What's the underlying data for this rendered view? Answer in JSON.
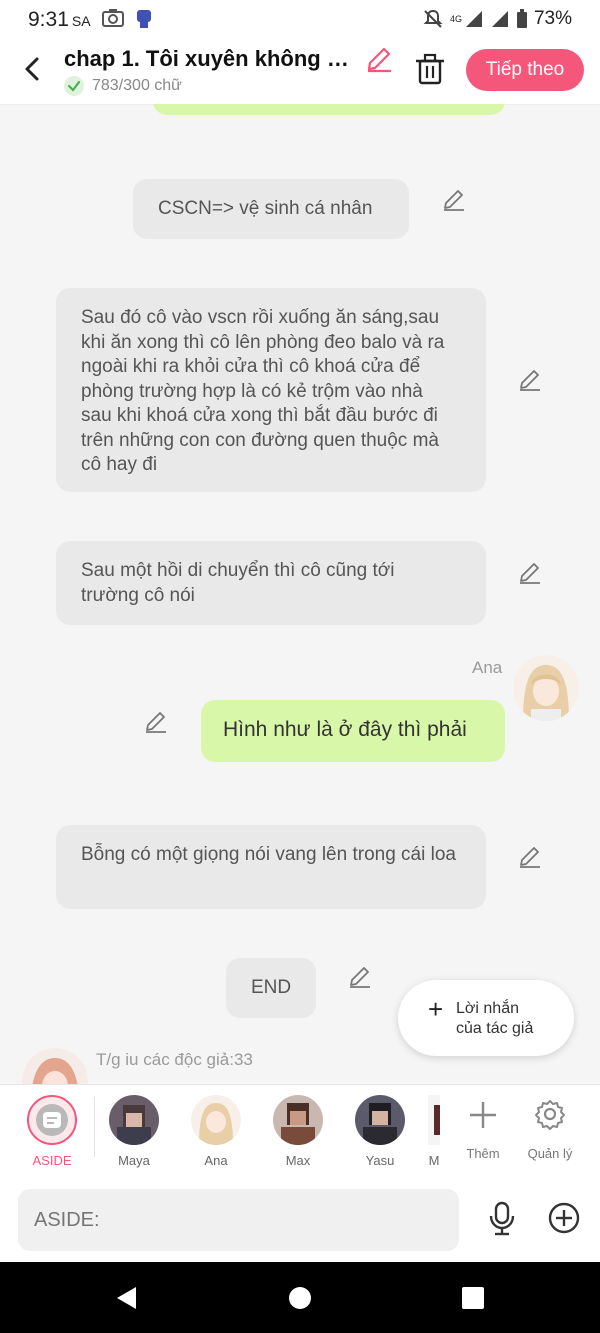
{
  "status": {
    "time": "9:31",
    "ampm": "SA",
    "network": "4G",
    "battery": "73%"
  },
  "header": {
    "title": "chap 1. Tôi xuyên không v...",
    "word_count": "783/300 chữ",
    "next_label": "Tiếp theo"
  },
  "messages": [
    {
      "type": "narration",
      "text": "CSCN=> vệ sinh cá nhân"
    },
    {
      "type": "narration",
      "text": "Sau đó cô vào vscn rồi xuống ăn sáng,sau khi ăn xong thì cô lên phòng đeo balo và ra ngoài khi ra khỏi cửa thì cô khoá cửa để phòng trường hợp là có kẻ trộm vào nhà sau khi khoá cửa xong thì bắt đầu bước đi trên những con con đường quen thuộc mà cô hay đi"
    },
    {
      "type": "narration",
      "text": "Sau một hồi di chuyển thì cô cũng tới trường cô nói"
    },
    {
      "type": "character",
      "name": "Ana",
      "text": "Hình như là ở đây thì phải"
    },
    {
      "type": "narration",
      "text": "Bỗng có một giọng nói vang lên trong cái loa"
    },
    {
      "type": "narration",
      "text": "END"
    }
  ],
  "author_note": {
    "text": "T/g iu các độc giả:33"
  },
  "fab": {
    "line1": "Lời nhắn",
    "line2": "của tác giả"
  },
  "characters": [
    {
      "name": "ASIDE",
      "active": true
    },
    {
      "name": "Maya"
    },
    {
      "name": "Ana"
    },
    {
      "name": "Max"
    },
    {
      "name": "Yasu"
    },
    {
      "name": "M"
    }
  ],
  "tools": {
    "add_label": "Thêm",
    "manage_label": "Quản lý"
  },
  "input": {
    "placeholder": "ASIDE:"
  },
  "colors": {
    "accent": "#f4577a",
    "character_bubble": "#d9f7a8",
    "narration_bubble": "#e9e9e9"
  }
}
